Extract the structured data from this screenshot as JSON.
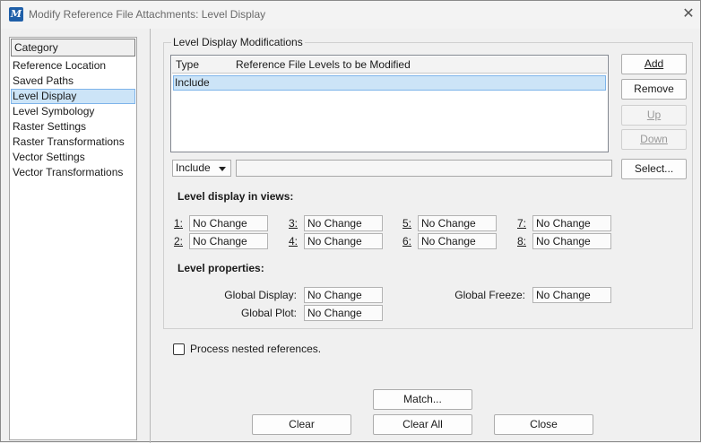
{
  "window": {
    "title": "Modify Reference File Attachments: Level Display",
    "app_icon": "M"
  },
  "category": {
    "header": "Category",
    "items": [
      "Reference Location",
      "Saved Paths",
      "Level Display",
      "Level Symbology",
      "Raster Settings",
      "Raster Transformations",
      "Vector Settings",
      "Vector Transformations"
    ],
    "selected": "Level Display"
  },
  "group_label": "Level Display Modifications",
  "table": {
    "columns": [
      "Type",
      "Reference File Levels to be Modified"
    ],
    "rows": [
      {
        "type": "Include",
        "levels": ""
      }
    ]
  },
  "side_buttons": {
    "add": "Add",
    "remove": "Remove",
    "up": "Up",
    "down": "Down",
    "select": "Select..."
  },
  "type_combo": {
    "value": "Include"
  },
  "level_input": {
    "value": ""
  },
  "views": {
    "heading": "Level display in views:",
    "items": [
      {
        "num": "1:",
        "value": "No Change"
      },
      {
        "num": "3:",
        "value": "No Change"
      },
      {
        "num": "5:",
        "value": "No Change"
      },
      {
        "num": "7:",
        "value": "No Change"
      },
      {
        "num": "2:",
        "value": "No Change"
      },
      {
        "num": "4:",
        "value": "No Change"
      },
      {
        "num": "6:",
        "value": "No Change"
      },
      {
        "num": "8:",
        "value": "No Change"
      }
    ]
  },
  "properties": {
    "heading": "Level properties:",
    "global_display": {
      "label": "Global Display:",
      "value": "No Change"
    },
    "global_freeze": {
      "label": "Global Freeze:",
      "value": "No Change"
    },
    "global_plot": {
      "label": "Global Plot:",
      "value": "No Change"
    }
  },
  "nested": {
    "label": "Process nested references.",
    "checked": false
  },
  "bottom_buttons": {
    "match": "Match...",
    "clear": "Clear",
    "clear_all": "Clear All",
    "close": "Close"
  }
}
